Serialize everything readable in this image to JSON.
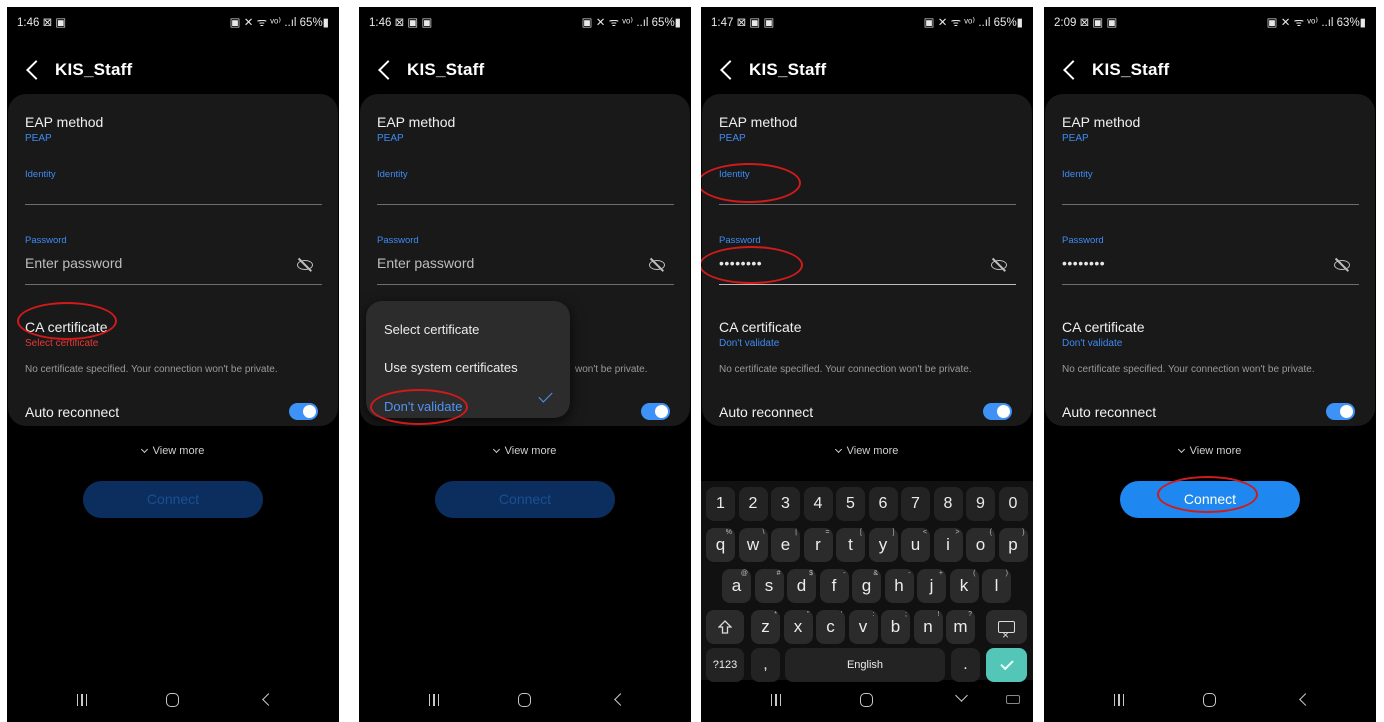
{
  "screens": [
    {
      "status": {
        "time": "1:46 ⊠ ▣",
        "icons": "▣ ✕ ᯤ ᵛᵒ⁾ ..ıl 65%▮"
      },
      "header": {
        "title": "KIS_Staff"
      },
      "eap": {
        "label": "EAP method",
        "value": "PEAP"
      },
      "identity": {
        "label": "Identity"
      },
      "password": {
        "label": "Password",
        "placeholder": "Enter password"
      },
      "ca": {
        "label": "CA certificate",
        "value": "Select certificate"
      },
      "note": "No certificate specified. Your connection won't be private.",
      "auto": {
        "label": "Auto reconnect",
        "on": true
      },
      "view_more": "View more",
      "connect": {
        "label": "Connect",
        "enabled": false
      }
    },
    {
      "status": {
        "time": "1:46 ⊠ ▣ ▣",
        "icons": "▣ ✕ ᯤ ᵛᵒ⁾ ..ıl 65%▮"
      },
      "header": {
        "title": "KIS_Staff"
      },
      "eap": {
        "label": "EAP method",
        "value": "PEAP"
      },
      "identity": {
        "label": "Identity"
      },
      "password": {
        "label": "Password",
        "placeholder": "Enter password"
      },
      "note_partial": "won't be private.",
      "auto": {
        "on": true
      },
      "view_more": "View more",
      "connect": {
        "label": "Connect",
        "enabled": false
      },
      "dropdown": {
        "options": [
          "Select certificate",
          "Use system certificates",
          "Don't validate"
        ],
        "selected": "Don't validate"
      }
    },
    {
      "status": {
        "time": "1:47 ⊠ ▣ ▣",
        "icons": "▣ ✕ ᯤ ᵛᵒ⁾ ..ıl 65%▮"
      },
      "header": {
        "title": "KIS_Staff"
      },
      "eap": {
        "label": "EAP method",
        "value": "PEAP"
      },
      "identity": {
        "label": "Identity"
      },
      "password": {
        "label": "Password",
        "value": "••••••••"
      },
      "ca": {
        "label": "CA certificate",
        "value": "Don't validate"
      },
      "note": "No certificate specified. Your connection won't be private.",
      "auto": {
        "label": "Auto reconnect",
        "on": true
      },
      "view_more": "View more",
      "keyboard": {
        "numbers": [
          "1",
          "2",
          "3",
          "4",
          "5",
          "6",
          "7",
          "8",
          "9",
          "0"
        ],
        "row1": [
          [
            "q",
            "%"
          ],
          [
            "w",
            "\\"
          ],
          [
            "e",
            "|"
          ],
          [
            "r",
            "="
          ],
          [
            "t",
            "["
          ],
          [
            "y",
            "]"
          ],
          [
            "u",
            "<"
          ],
          [
            "i",
            ">"
          ],
          [
            "o",
            "{"
          ],
          [
            "p",
            "}"
          ]
        ],
        "row2": [
          [
            "a",
            "@"
          ],
          [
            "s",
            "#"
          ],
          [
            "d",
            "$"
          ],
          [
            "f",
            "-"
          ],
          [
            "g",
            "&"
          ],
          [
            "h",
            "-"
          ],
          [
            "j",
            "+"
          ],
          [
            "k",
            "("
          ],
          [
            "l",
            ")"
          ]
        ],
        "row3": [
          [
            "z",
            "*"
          ],
          [
            "x",
            "\""
          ],
          [
            "c",
            "'"
          ],
          [
            "v",
            ":"
          ],
          [
            "b",
            ";"
          ],
          [
            "n",
            "!"
          ],
          [
            "m",
            "?"
          ]
        ],
        "symbols_label": "?123",
        "comma": ",",
        "space_label": "English",
        "period": "."
      }
    },
    {
      "status": {
        "time": "2:09 ⊠ ▣ ▣",
        "icons": "▣ ✕ ᯤ ᵛᵒ⁾ ..ıl 63%▮"
      },
      "header": {
        "title": "KIS_Staff"
      },
      "eap": {
        "label": "EAP method",
        "value": "PEAP"
      },
      "identity": {
        "label": "Identity"
      },
      "password": {
        "label": "Password",
        "value": "••••••••"
      },
      "ca": {
        "label": "CA certificate",
        "value": "Don't validate"
      },
      "note": "No certificate specified. Your connection won't be private.",
      "auto": {
        "label": "Auto reconnect",
        "on": true
      },
      "view_more": "View more",
      "connect": {
        "label": "Connect",
        "enabled": true
      }
    }
  ],
  "colors": {
    "accent": "#3f8bf3",
    "annotation": "#d11a1a",
    "error": "#e53935",
    "connect_active": "#1e88f0",
    "connect_disabled": "#0b2e5e"
  }
}
